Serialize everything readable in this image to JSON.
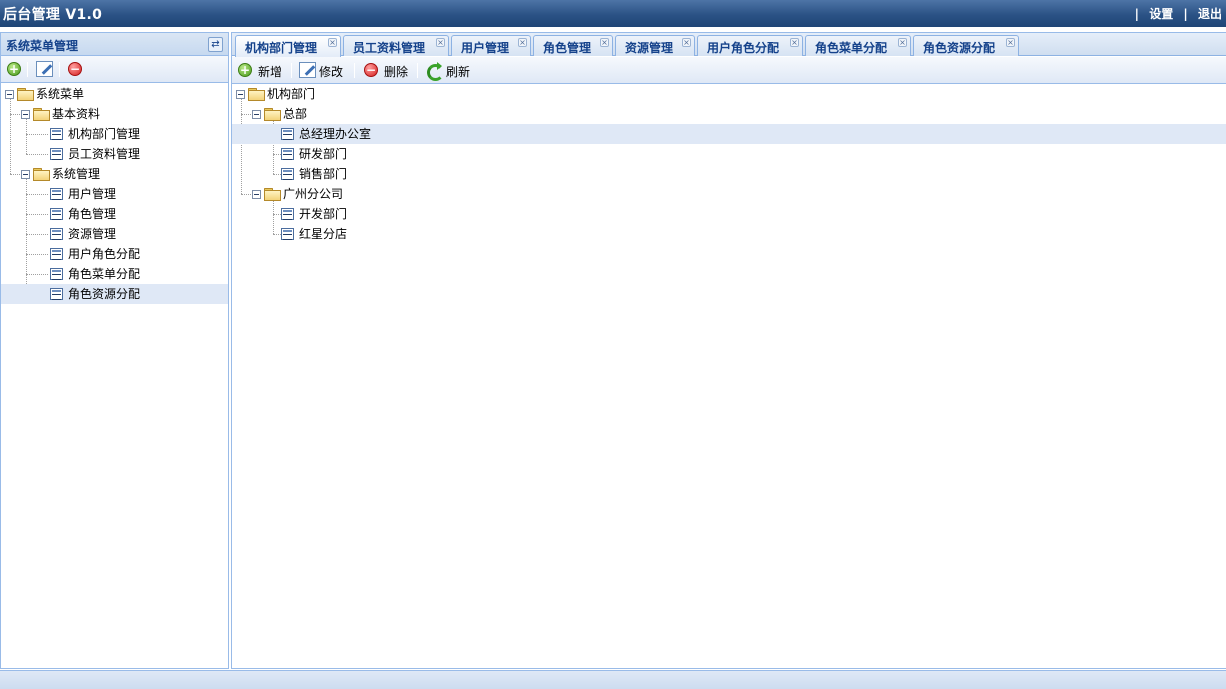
{
  "header": {
    "title": "后台管理 V1.0",
    "separator": "|",
    "links": [
      "设置",
      "退出"
    ]
  },
  "west": {
    "title": "系统菜单管理",
    "collapse_icon": "refresh-collapse-icon",
    "toolbar": [
      "add-icon",
      "edit-icon",
      "delete-icon"
    ],
    "tree": {
      "root": "系统菜单",
      "groups": [
        {
          "label": "基本资料",
          "items": [
            "机构部门管理",
            "员工资料管理"
          ]
        },
        {
          "label": "系统管理",
          "items": [
            "用户管理",
            "角色管理",
            "资源管理",
            "用户角色分配",
            "角色菜单分配",
            "角色资源分配"
          ]
        }
      ],
      "selected": "角色资源分配"
    }
  },
  "tabs": [
    {
      "label": "机构部门管理",
      "active": true
    },
    {
      "label": "员工资料管理",
      "active": false
    },
    {
      "label": "用户管理",
      "active": false
    },
    {
      "label": "角色管理",
      "active": false
    },
    {
      "label": "资源管理",
      "active": false
    },
    {
      "label": "用户角色分配",
      "active": false
    },
    {
      "label": "角色菜单分配",
      "active": false
    },
    {
      "label": "角色资源分配",
      "active": false
    }
  ],
  "toolbar": {
    "add": "新增",
    "edit": "修改",
    "delete": "删除",
    "refresh": "刷新"
  },
  "dept_tree": {
    "root": "机构部门",
    "groups": [
      {
        "label": "总部",
        "items": [
          "总经理办公室",
          "研发部门",
          "销售部门"
        ]
      },
      {
        "label": "广州分公司",
        "items": [
          "开发部门",
          "红星分店"
        ]
      }
    ],
    "selected": "总经理办公室"
  }
}
